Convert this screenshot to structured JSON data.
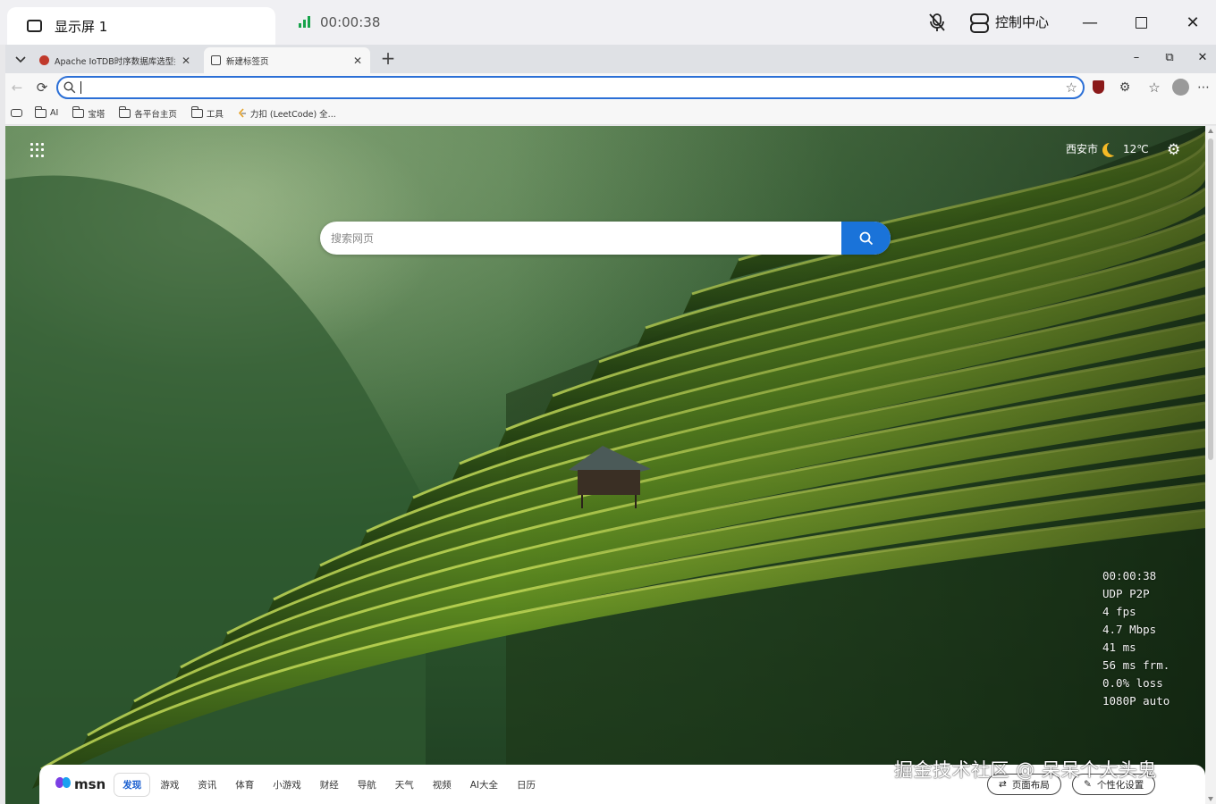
{
  "remote_desktop": {
    "monitor_label": "显示屏 1",
    "session_time": "00:00:38",
    "control_center_label": "控制中心",
    "minimize_icon": "minimize-icon",
    "maximize_icon": "maximize-icon",
    "close_icon": "close-icon"
  },
  "browser": {
    "tabs": [
      {
        "label": "Apache IoTDB时序数据库选型指南",
        "active": false
      },
      {
        "label": "新建标签页",
        "active": true
      }
    ],
    "address": {
      "value": ""
    },
    "bookmarks": [
      {
        "label": "AI",
        "icon": "folder-icon"
      },
      {
        "label": "宝塔",
        "icon": "folder-icon"
      },
      {
        "label": "各平台主页",
        "icon": "folder-icon"
      },
      {
        "label": "工具",
        "icon": "folder-icon"
      },
      {
        "label": "力扣 (LeetCode) 全...",
        "icon": "leetcode-icon"
      }
    ]
  },
  "new_tab_page": {
    "weather": {
      "city": "西安市",
      "temp": "12℃",
      "icon": "moon-icon"
    },
    "search": {
      "placeholder": "搜索网页"
    },
    "stream_stats": [
      "00:00:38",
      "UDP P2P",
      "4 fps",
      "4.7 Mbps",
      "41 ms",
      "56 ms frm.",
      "0.0% loss",
      "1080P auto"
    ],
    "msn": {
      "logo": "msn",
      "nav": [
        "发现",
        "游戏",
        "资讯",
        "体育",
        "小游戏",
        "财经",
        "导航",
        "天气",
        "视频",
        "AI大全",
        "日历"
      ],
      "active_nav": "发现",
      "layout_button": "页面布局",
      "personalize_button": "个性化设置"
    }
  },
  "watermark": "掘金技术社区 @ 呆呆个大头鬼",
  "colors": {
    "accent": "#1a73d9",
    "signal": "#16a34a",
    "address_border": "#2b6fd6"
  }
}
